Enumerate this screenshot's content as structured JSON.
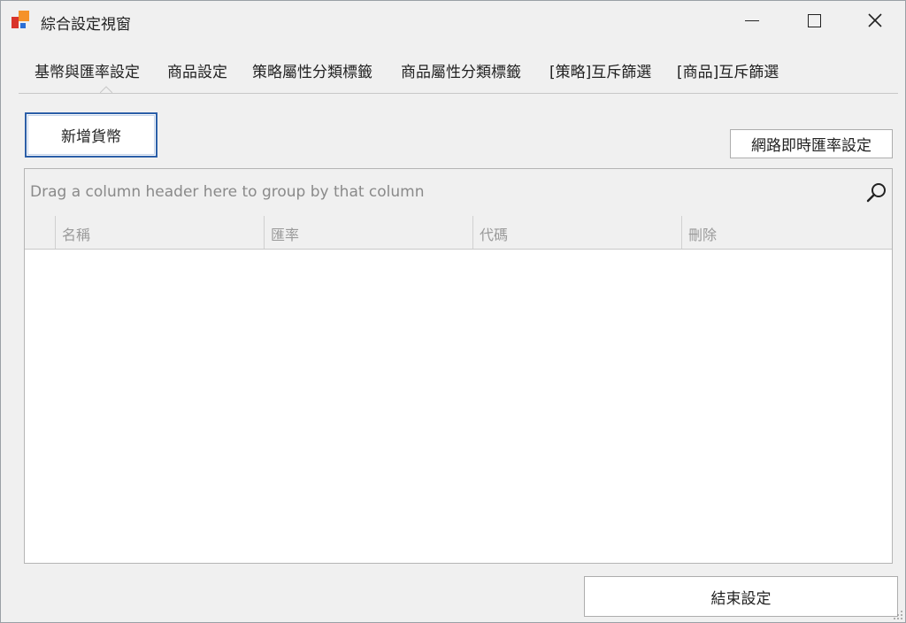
{
  "window": {
    "title": "綜合設定視窗"
  },
  "tabs": [
    {
      "label": "基幣與匯率設定"
    },
    {
      "label": "商品設定"
    },
    {
      "label": "策略屬性分類標籤"
    },
    {
      "label": "商品屬性分類標籤"
    },
    {
      "label": "[策略]互斥篩選"
    },
    {
      "label": "[商品]互斥篩選"
    }
  ],
  "toolbar": {
    "add_currency_label": "新增貨幣",
    "online_rate_label": "網路即時匯率設定"
  },
  "grid": {
    "group_panel_text": "Drag a column header here to group by that column",
    "columns": [
      {
        "label": "名稱"
      },
      {
        "label": "匯率"
      },
      {
        "label": "代碼"
      },
      {
        "label": "刪除"
      }
    ]
  },
  "footer": {
    "finish_label": "結束設定"
  },
  "colors": {
    "accent": "#2c5fa8",
    "background": "#f0f0f0"
  }
}
